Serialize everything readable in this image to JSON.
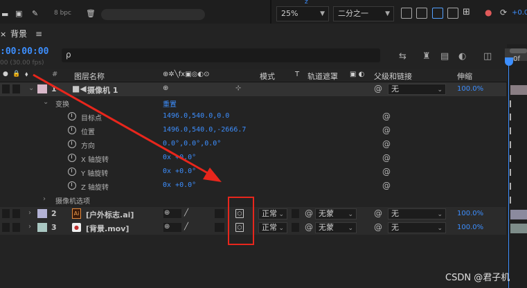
{
  "topbar": {
    "bpc": "8 bpc",
    "zoom": "25%",
    "resolution": "二分之一",
    "plus_value": "+0.0"
  },
  "comp": {
    "tab_title": "背景",
    "timecode": ":00:00:00",
    "fps": "00 (30.00 fps)",
    "search_placeholder": "ρ"
  },
  "columns": {
    "hash": "#",
    "layer_name": "图层名称",
    "mode": "模式",
    "t": "T",
    "track_matte": "轨道遮罩",
    "parent": "父级和链接",
    "stretch": "伸缩"
  },
  "timeline": {
    "ruler_label": "0f"
  },
  "layers": [
    {
      "num": "1",
      "name": "摄像机 1",
      "parent": "无",
      "stretch": "100.0%",
      "label_color": "#d9b8c9"
    },
    {
      "num": "2",
      "name": "[户外标志.ai]",
      "mode": "正常",
      "matte": "无蒙",
      "parent": "无",
      "stretch": "100.0%",
      "label_color": "#b4b3d6"
    },
    {
      "num": "3",
      "name": "[背景.mov]",
      "mode": "正常",
      "matte": "无蒙",
      "parent": "无",
      "stretch": "100.0%",
      "label_color": "#a9c7c2"
    }
  ],
  "transform": {
    "label": "变换",
    "reset": "重置",
    "props": [
      {
        "name": "目标点",
        "value": "1496.0,540.0,0.0"
      },
      {
        "name": "位置",
        "value": "1496.0,540.0,-2666.7"
      },
      {
        "name": "方向",
        "value": "0.0°,0.0°,0.0°"
      },
      {
        "name": "X 轴旋转",
        "value": "0x +0.0°"
      },
      {
        "name": "Y 轴旋转",
        "value": "0x +0.0°"
      },
      {
        "name": "Z 轴旋转",
        "value": "0x +0.0°"
      }
    ]
  },
  "camera_options": "摄像机选项",
  "watermark": "CSDN @君子机",
  "colors": {
    "accent": "#3d8fff",
    "annotation": "#e8261c"
  }
}
